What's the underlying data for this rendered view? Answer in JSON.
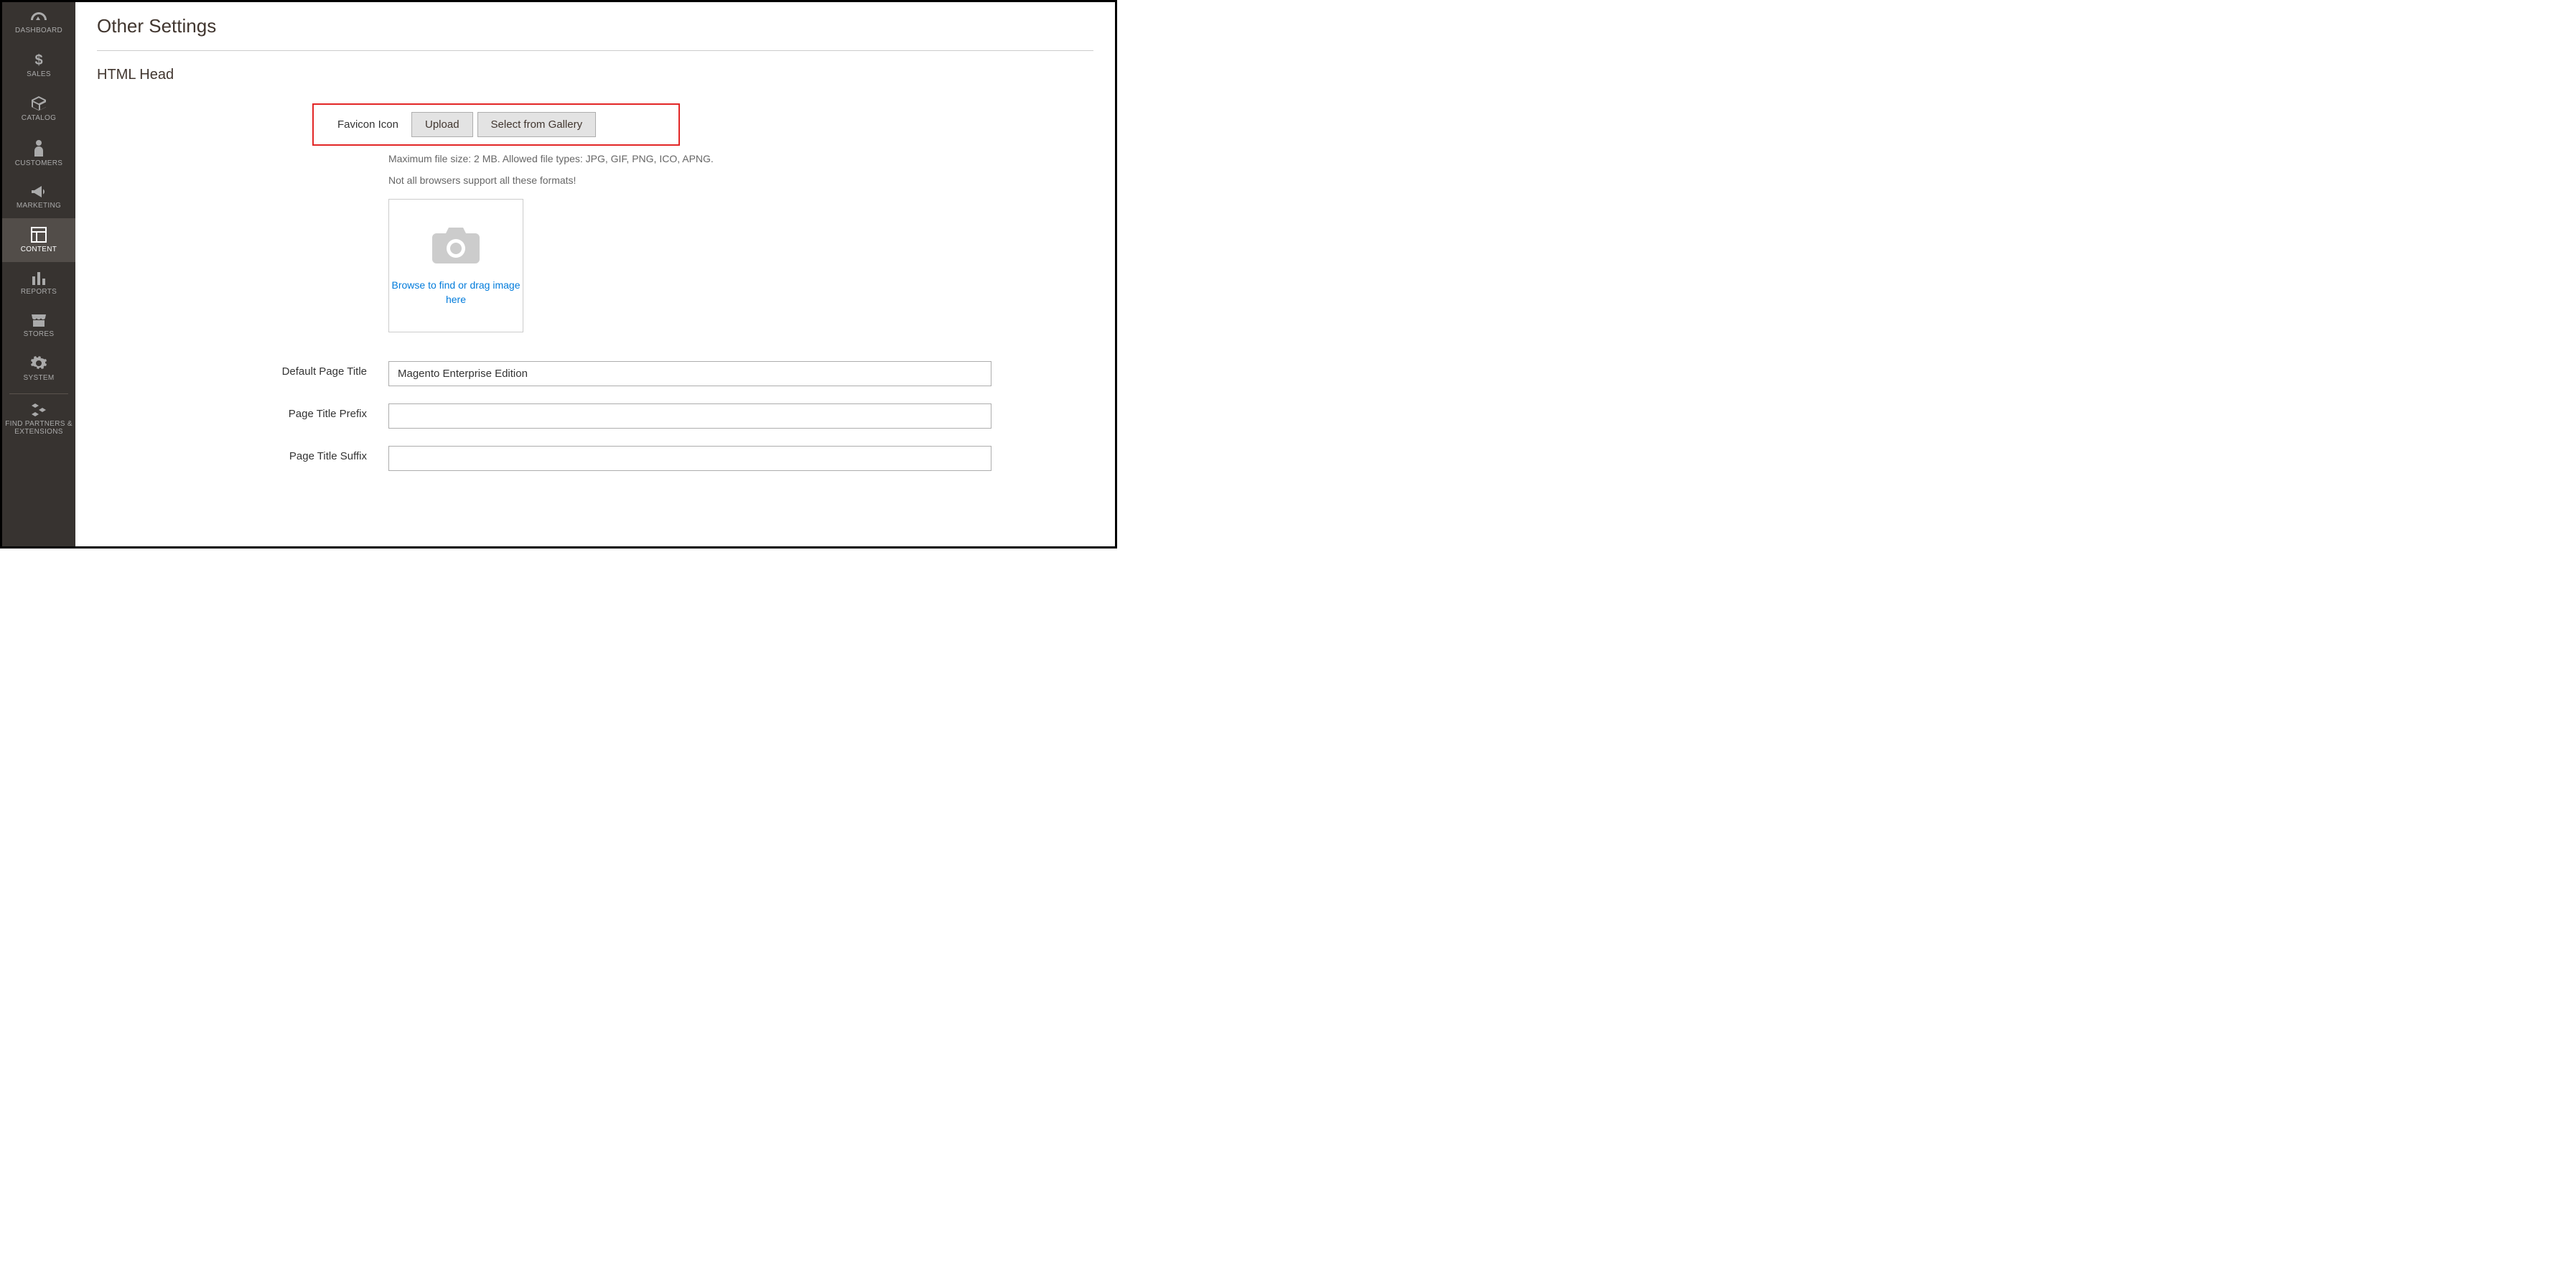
{
  "sidebar": {
    "items": [
      {
        "label": "DASHBOARD",
        "icon": "dashboard"
      },
      {
        "label": "SALES",
        "icon": "dollar"
      },
      {
        "label": "CATALOG",
        "icon": "box"
      },
      {
        "label": "CUSTOMERS",
        "icon": "person"
      },
      {
        "label": "MARKETING",
        "icon": "megaphone"
      },
      {
        "label": "CONTENT",
        "icon": "layout"
      },
      {
        "label": "REPORTS",
        "icon": "bars"
      },
      {
        "label": "STORES",
        "icon": "storefront"
      },
      {
        "label": "SYSTEM",
        "icon": "gear"
      },
      {
        "label": "FIND PARTNERS & EXTENSIONS",
        "icon": "blocks"
      }
    ]
  },
  "page": {
    "title": "Other Settings",
    "section": "HTML Head"
  },
  "favicon": {
    "label": "Favicon Icon",
    "upload": "Upload",
    "gallery": "Select from Gallery",
    "hint1": "Maximum file size: 2 MB. Allowed file types: JPG, GIF, PNG, ICO, APNG.",
    "hint2": "Not all browsers support all these formats!",
    "dropzone": "Browse to find or drag image here"
  },
  "fields": {
    "default_title": {
      "label": "Default Page Title",
      "value": "Magento Enterprise Edition"
    },
    "prefix": {
      "label": "Page Title Prefix",
      "value": ""
    },
    "suffix": {
      "label": "Page Title Suffix",
      "value": ""
    }
  }
}
